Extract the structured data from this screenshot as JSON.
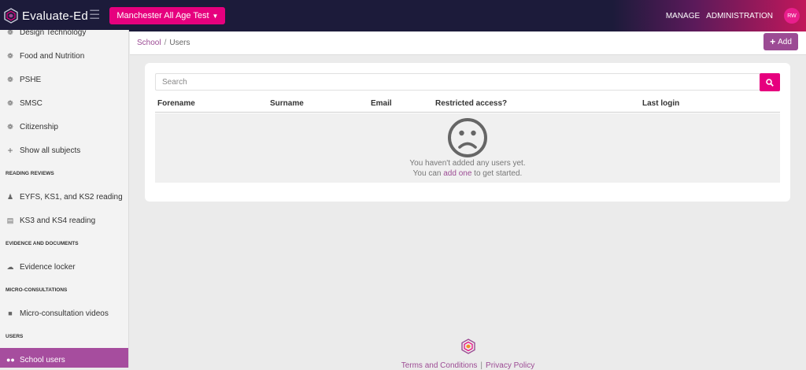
{
  "brand": {
    "name": "Evaluate-Ed",
    "accent": "#e6007e",
    "purple": "#9c4b94",
    "dark": "#1c1b3a"
  },
  "topbar": {
    "school_selector": "Manchester All Age Test",
    "nav": [
      "MANAGE",
      "ADMINISTRATION"
    ],
    "avatar_initials": "RW"
  },
  "sidebar": {
    "subjects": [
      {
        "label": "Design Technology",
        "icon": "brain-icon"
      },
      {
        "label": "Food and Nutrition",
        "icon": "brain-icon"
      },
      {
        "label": "PSHE",
        "icon": "brain-icon"
      },
      {
        "label": "SMSC",
        "icon": "brain-icon"
      },
      {
        "label": "Citizenship",
        "icon": "brain-icon"
      },
      {
        "label": "Show all subjects",
        "icon": "plus-icon"
      }
    ],
    "reading_heading": "READING REVIEWS",
    "reading": [
      {
        "label": "EYFS, KS1, and KS2 reading",
        "icon": "child-reading-icon"
      },
      {
        "label": "KS3 and KS4 reading",
        "icon": "book-icon"
      }
    ],
    "evidence_heading": "EVIDENCE AND DOCUMENTS",
    "evidence": [
      {
        "label": "Evidence locker",
        "icon": "cloud-upload-icon"
      }
    ],
    "micro_heading": "MICRO-CONSULTATIONS",
    "micro": [
      {
        "label": "Micro-consultation videos",
        "icon": "video-icon"
      }
    ],
    "users_heading": "USERS",
    "users": [
      {
        "label": "School users",
        "icon": "users-icon"
      }
    ]
  },
  "breadcrumb": {
    "parent": "School",
    "separator": "/",
    "current": "Users"
  },
  "add_button": {
    "label": "Add"
  },
  "search": {
    "placeholder": "Search"
  },
  "table": {
    "columns": [
      "Forename",
      "Surname",
      "Email",
      "Restricted access?",
      "Last login"
    ]
  },
  "empty_state": {
    "line1": "You haven't added any users yet.",
    "line2_prefix": "You can ",
    "line2_link": "add one",
    "line2_suffix": " to get started."
  },
  "footer": {
    "terms": "Terms and Conditions",
    "separator": "|",
    "privacy": "Privacy Policy"
  }
}
